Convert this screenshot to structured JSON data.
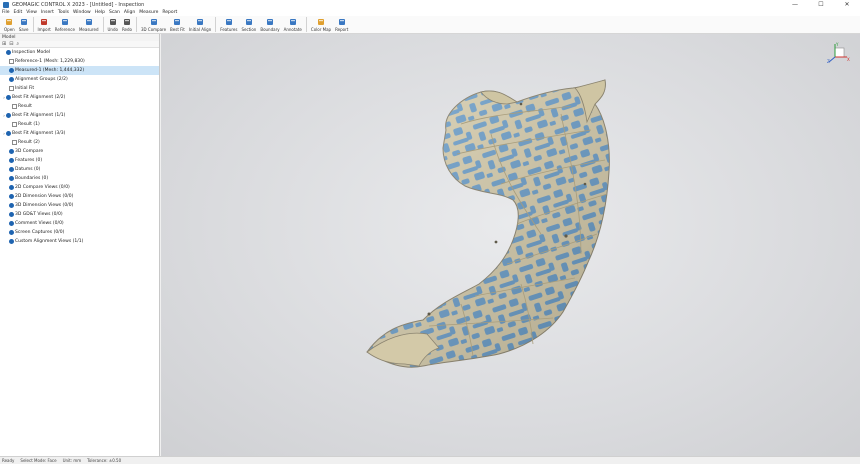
{
  "window": {
    "title": "GEOMAGIC CONTROL X 2023 - [Untitled] - Inspection",
    "controls": [
      "—",
      "☐",
      "✕"
    ]
  },
  "menu": [
    "File",
    "Edit",
    "View",
    "Insert",
    "Tools",
    "Window",
    "Help",
    "Scan",
    "Align",
    "Measure",
    "Report"
  ],
  "toolbar": {
    "buttons": [
      {
        "label": "Open",
        "icon": "open-icon",
        "color": "#e0a030"
      },
      {
        "label": "Save",
        "icon": "save-icon",
        "color": "#3a78c2"
      },
      {
        "label": "Import",
        "icon": "import-icon",
        "color": "#c0392b"
      },
      {
        "label": "Reference",
        "icon": "reference-icon",
        "color": "#3a78c2"
      },
      {
        "label": "Measured",
        "icon": "measured-icon",
        "color": "#3a78c2"
      },
      {
        "label": "Undo",
        "icon": "undo-icon",
        "color": "#555555"
      },
      {
        "label": "Redo",
        "icon": "redo-icon",
        "color": "#555555"
      },
      {
        "label": "3D Compare",
        "icon": "compare-icon",
        "color": "#3a78c2"
      },
      {
        "label": "Best Fit",
        "icon": "best-fit-icon",
        "color": "#3a78c2"
      },
      {
        "label": "Initial Align",
        "icon": "initial-align-icon",
        "color": "#3a78c2"
      },
      {
        "label": "Features",
        "icon": "features-icon",
        "color": "#3a78c2"
      },
      {
        "label": "Section",
        "icon": "section-icon",
        "color": "#3a78c2"
      },
      {
        "label": "Boundary",
        "icon": "boundary-icon",
        "color": "#3a78c2"
      },
      {
        "label": "Annotate",
        "icon": "annotate-icon",
        "color": "#3a78c2"
      },
      {
        "label": "Color Map",
        "icon": "color-map-icon",
        "color": "#e0a030"
      },
      {
        "label": "Report",
        "icon": "report-icon",
        "color": "#3a78c2"
      }
    ]
  },
  "left_panel": {
    "header": "Model",
    "tools": [
      "⊞",
      "⊟",
      "⌕"
    ],
    "tree": [
      {
        "label": "Inspection Model",
        "indent": 0,
        "check": "on",
        "arrow": "",
        "selected": false
      },
      {
        "label": "Reference-1 (Mesh: 1,229,830)",
        "indent": 1,
        "check": "off",
        "arrow": "",
        "selected": false
      },
      {
        "label": "Measured-1 (Mesh: 1,444,332)",
        "indent": 1,
        "check": "on",
        "arrow": "",
        "selected": true
      },
      {
        "label": "Alignment Groups (2/2)",
        "indent": 1,
        "check": "on",
        "arrow": "",
        "selected": false
      },
      {
        "label": "Initial Fit",
        "indent": 1,
        "check": "off",
        "arrow": "",
        "selected": false
      },
      {
        "label": "Best Fit Alignment (2/2)",
        "indent": 0,
        "check": "on",
        "arrow": "›",
        "selected": false
      },
      {
        "label": "Result",
        "indent": 2,
        "check": "off",
        "arrow": "",
        "selected": false
      },
      {
        "label": "Best Fit Alignment (1/1)",
        "indent": 0,
        "check": "on",
        "arrow": "›",
        "selected": false
      },
      {
        "label": "Result (1)",
        "indent": 2,
        "check": "off",
        "arrow": "",
        "selected": false
      },
      {
        "label": "Best Fit Alignment (3/3)",
        "indent": 0,
        "check": "on",
        "arrow": "›",
        "selected": false
      },
      {
        "label": "Result (2)",
        "indent": 2,
        "check": "off",
        "arrow": "",
        "selected": false
      },
      {
        "label": "3D Compare",
        "indent": 1,
        "check": "on",
        "arrow": "",
        "selected": false
      },
      {
        "label": "Features (0)",
        "indent": 1,
        "check": "on",
        "arrow": "",
        "selected": false
      },
      {
        "label": "Datums (0)",
        "indent": 1,
        "check": "on",
        "arrow": "",
        "selected": false
      },
      {
        "label": "Boundaries (0)",
        "indent": 1,
        "check": "on",
        "arrow": "",
        "selected": false
      },
      {
        "label": "2D Compare Views (0/0)",
        "indent": 1,
        "check": "on",
        "arrow": "",
        "selected": false
      },
      {
        "label": "2D Dimension Views (0/0)",
        "indent": 1,
        "check": "on",
        "arrow": "",
        "selected": false
      },
      {
        "label": "3D Dimension Views (0/0)",
        "indent": 1,
        "check": "on",
        "arrow": "",
        "selected": false
      },
      {
        "label": "3D GD&T Views (0/0)",
        "indent": 1,
        "check": "on",
        "arrow": "",
        "selected": false
      },
      {
        "label": "Comment Views (0/0)",
        "indent": 1,
        "check": "on",
        "arrow": "",
        "selected": false
      },
      {
        "label": "Screen Captures (0/0)",
        "indent": 1,
        "check": "on",
        "arrow": "",
        "selected": false
      },
      {
        "label": "Custom Alignment Views (1/1)",
        "indent": 1,
        "check": "on",
        "arrow": "",
        "selected": false
      }
    ]
  },
  "viewport": {
    "model_colors": {
      "base": "#d9cfae",
      "deviation": "#6b9fcc",
      "edge": "#a89d7c",
      "outline": "#8b8470"
    },
    "axis_colors": {
      "x": "#d0312d",
      "y": "#2b9c3a",
      "z": "#2f5fc4"
    },
    "axis_letters": [
      "X",
      "Y",
      "Z"
    ]
  },
  "status": [
    "Ready",
    "Select Mode: Face",
    "Unit: mm",
    "Tolerance: ±0.50"
  ]
}
